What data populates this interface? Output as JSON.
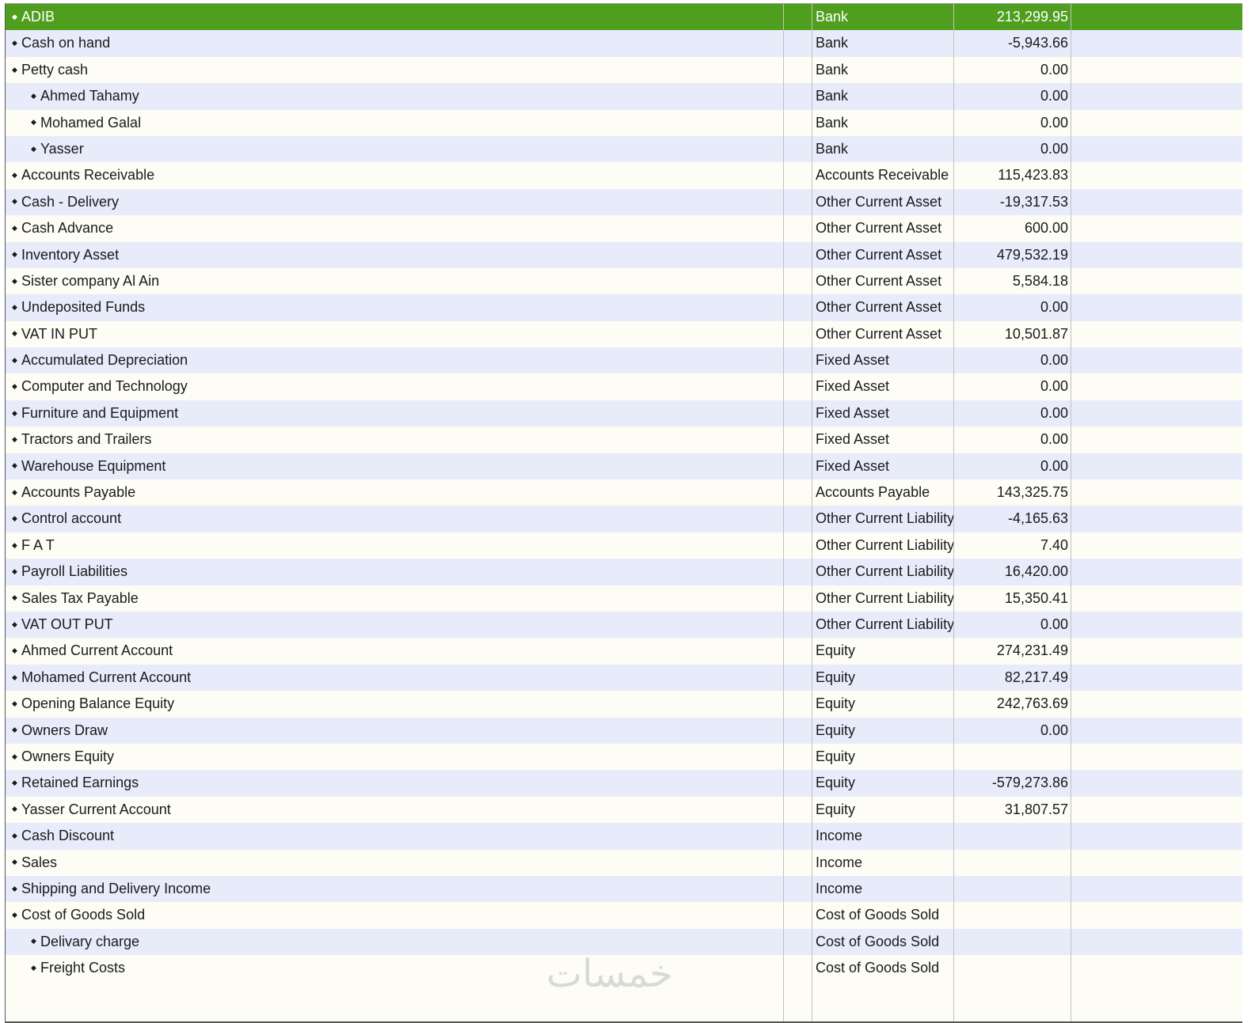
{
  "colors": {
    "selected_row": "#4f9e1e",
    "odd_row": "#fdfdf5",
    "even_row": "#e8ebfa",
    "grid_line": "#c2c2c2"
  },
  "row_icon": "diamond-bullet-icon",
  "watermark": "خمسات",
  "accounts": [
    {
      "name": "ADIB",
      "type": "Bank",
      "balance": "213,299.95",
      "level": 0,
      "selected": true
    },
    {
      "name": "Cash on hand",
      "type": "Bank",
      "balance": "-5,943.66",
      "level": 0
    },
    {
      "name": "Petty cash",
      "type": "Bank",
      "balance": "0.00",
      "level": 0
    },
    {
      "name": "Ahmed Tahamy",
      "type": "Bank",
      "balance": "0.00",
      "level": 1
    },
    {
      "name": "Mohamed Galal",
      "type": "Bank",
      "balance": "0.00",
      "level": 1
    },
    {
      "name": "Yasser",
      "type": "Bank",
      "balance": "0.00",
      "level": 1
    },
    {
      "name": "Accounts Receivable",
      "type": "Accounts Receivable",
      "balance": "115,423.83",
      "level": 0
    },
    {
      "name": "Cash - Delivery",
      "type": "Other Current Asset",
      "balance": "-19,317.53",
      "level": 0
    },
    {
      "name": "Cash Advance",
      "type": "Other Current Asset",
      "balance": "600.00",
      "level": 0
    },
    {
      "name": "Inventory Asset",
      "type": "Other Current Asset",
      "balance": "479,532.19",
      "level": 0
    },
    {
      "name": "Sister company Al Ain",
      "type": "Other Current Asset",
      "balance": "5,584.18",
      "level": 0
    },
    {
      "name": "Undeposited Funds",
      "type": "Other Current Asset",
      "balance": "0.00",
      "level": 0
    },
    {
      "name": "VAT IN PUT",
      "type": "Other Current Asset",
      "balance": "10,501.87",
      "level": 0
    },
    {
      "name": "Accumulated Depreciation",
      "type": "Fixed Asset",
      "balance": "0.00",
      "level": 0
    },
    {
      "name": "Computer and Technology",
      "type": "Fixed Asset",
      "balance": "0.00",
      "level": 0
    },
    {
      "name": "Furniture and Equipment",
      "type": "Fixed Asset",
      "balance": "0.00",
      "level": 0
    },
    {
      "name": "Tractors and Trailers",
      "type": "Fixed Asset",
      "balance": "0.00",
      "level": 0
    },
    {
      "name": "Warehouse Equipment",
      "type": "Fixed Asset",
      "balance": "0.00",
      "level": 0
    },
    {
      "name": "Accounts Payable",
      "type": "Accounts Payable",
      "balance": "143,325.75",
      "level": 0
    },
    {
      "name": "Control account",
      "type": "Other Current Liability",
      "balance": "-4,165.63",
      "level": 0
    },
    {
      "name": "F A T",
      "type": "Other Current Liability",
      "balance": "7.40",
      "level": 0
    },
    {
      "name": "Payroll Liabilities",
      "type": "Other Current Liability",
      "balance": "16,420.00",
      "level": 0
    },
    {
      "name": "Sales Tax Payable",
      "type": "Other Current Liability",
      "balance": "15,350.41",
      "level": 0
    },
    {
      "name": "VAT OUT PUT",
      "type": "Other Current Liability",
      "balance": "0.00",
      "level": 0
    },
    {
      "name": "Ahmed Current Account",
      "type": "Equity",
      "balance": "274,231.49",
      "level": 0
    },
    {
      "name": "Mohamed Current Account",
      "type": "Equity",
      "balance": "82,217.49",
      "level": 0
    },
    {
      "name": "Opening Balance Equity",
      "type": "Equity",
      "balance": "242,763.69",
      "level": 0
    },
    {
      "name": "Owners Draw",
      "type": "Equity",
      "balance": "0.00",
      "level": 0
    },
    {
      "name": "Owners Equity",
      "type": "Equity",
      "balance": "",
      "level": 0
    },
    {
      "name": "Retained Earnings",
      "type": "Equity",
      "balance": "-579,273.86",
      "level": 0
    },
    {
      "name": "Yasser Current Account",
      "type": "Equity",
      "balance": "31,807.57",
      "level": 0
    },
    {
      "name": "Cash Discount",
      "type": "Income",
      "balance": "",
      "level": 0
    },
    {
      "name": "Sales",
      "type": "Income",
      "balance": "",
      "level": 0
    },
    {
      "name": "Shipping and Delivery Income",
      "type": "Income",
      "balance": "",
      "level": 0
    },
    {
      "name": "Cost of Goods Sold",
      "type": "Cost of Goods Sold",
      "balance": "",
      "level": 0
    },
    {
      "name": "Delivary charge",
      "type": "Cost of Goods Sold",
      "balance": "",
      "level": 1
    },
    {
      "name": "Freight Costs",
      "type": "Cost of Goods Sold",
      "balance": "",
      "level": 1
    }
  ]
}
